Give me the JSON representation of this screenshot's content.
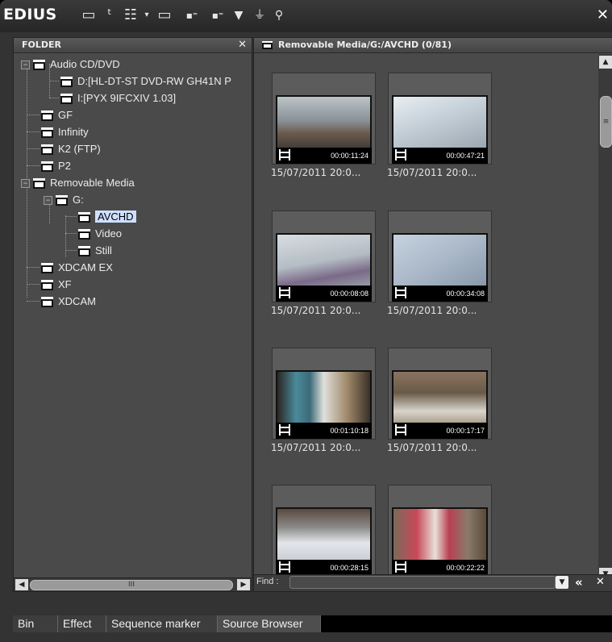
{
  "app": {
    "brand": "EDIUS"
  },
  "toolbar": {
    "icons": [
      "folder-icon",
      "up-level-icon",
      "view-mode-icon",
      "dropdown-arrow-icon",
      "window-icon",
      "import-icon",
      "export-icon",
      "pin-icon",
      "transfer-icon",
      "settings-icon"
    ],
    "close": "✕"
  },
  "folder_pane": {
    "title": "FOLDER",
    "close": "✕",
    "nodes": [
      {
        "label": "Audio CD/DVD"
      },
      {
        "label": "D:[HL-DT-ST DVD-RW GH41N P"
      },
      {
        "label": "I:[PYX 9IFCXIV 1.03]"
      },
      {
        "label": "GF"
      },
      {
        "label": "Infinity"
      },
      {
        "label": "K2 (FTP)"
      },
      {
        "label": "P2"
      },
      {
        "label": "Removable Media"
      },
      {
        "label": "G:"
      },
      {
        "label": "AVCHD"
      },
      {
        "label": "Video"
      },
      {
        "label": "Still"
      },
      {
        "label": "XDCAM EX"
      },
      {
        "label": "XF"
      },
      {
        "label": "XDCAM"
      }
    ]
  },
  "browser": {
    "path": "Removable Media/G:/AVCHD (0/81)",
    "clips": [
      {
        "timecode": "00:00:11:24",
        "date": "15/07/2011 20:0..."
      },
      {
        "timecode": "00:00:47:21",
        "date": "15/07/2011 20:0..."
      },
      {
        "timecode": "00:00:08:08",
        "date": "15/07/2011 20:0..."
      },
      {
        "timecode": "00:00:34:08",
        "date": "15/07/2011 20:0..."
      },
      {
        "timecode": "00:01:10:18",
        "date": "15/07/2011 20:0..."
      },
      {
        "timecode": "00:00:17:17",
        "date": "15/07/2011 20:0..."
      },
      {
        "timecode": "00:00:28:15",
        "date": ""
      },
      {
        "timecode": "00:00:22:22",
        "date": ""
      }
    ],
    "find_label": "Find :",
    "find_value": ""
  },
  "tabs": [
    {
      "label": "Bin"
    },
    {
      "label": "Effect"
    },
    {
      "label": "Sequence marker"
    },
    {
      "label": "Source Browser"
    }
  ],
  "colors": {
    "selection": "#cfe0ff",
    "background": "#4a4a4a"
  }
}
